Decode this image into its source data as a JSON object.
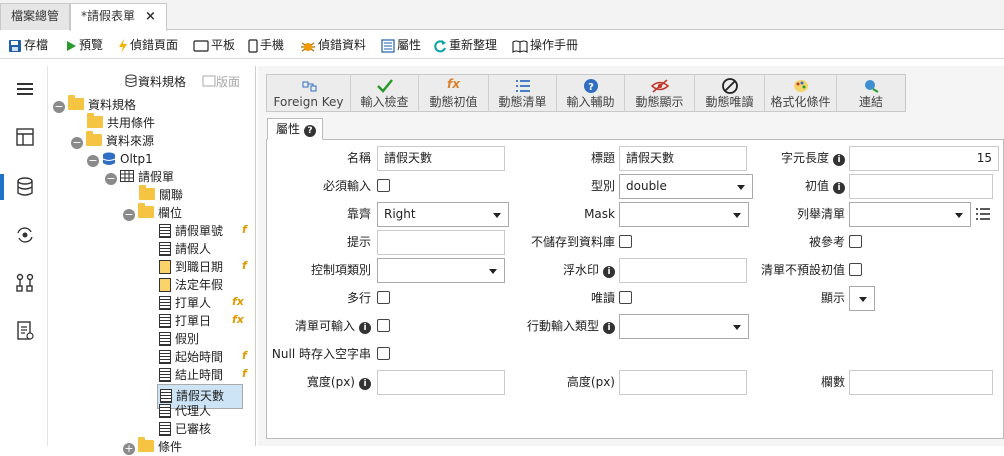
{
  "tabs": [
    {
      "label": "檔案總管"
    },
    {
      "label": "*請假表單",
      "close": "×"
    }
  ],
  "toolbar": {
    "save": "存檔",
    "preview": "預覽",
    "debug_page": "偵錯頁面",
    "tablet": "平板",
    "phone": "手機",
    "debug_data": "偵錯資料",
    "properties": "屬性",
    "reorganize": "重新整理",
    "manual": "操作手冊"
  },
  "tree_header": {
    "spec": "資料規格",
    "layout": "版面"
  },
  "tree": {
    "root": "資料規格",
    "common": "共用條件",
    "source": "資料來源",
    "db": "Oltp1",
    "table": "請假單",
    "relation": "關聯",
    "fields_group": "欄位",
    "fields": [
      "請假單號",
      "請假人",
      "到職日期",
      "法定年假",
      "打單人",
      "打單日",
      "假別",
      "起始時間",
      "結止時間",
      "請假天數",
      "代理人",
      "已審核"
    ],
    "conditions": "條件"
  },
  "ribbon": {
    "foreign_key": "Foreign Key",
    "input_check": "輸入檢查",
    "dyn_default": "動態初值",
    "dyn_list": "動態清單",
    "input_assist": "輸入輔助",
    "dyn_display": "動態顯示",
    "dyn_readonly": "動態唯讀",
    "format_cond": "格式化條件",
    "link": "連結"
  },
  "prop_tab": "屬性",
  "form": {
    "name_label": "名稱",
    "name_value": "請假天數",
    "title_label": "標題",
    "title_value": "請假天數",
    "length_label": "字元長度",
    "length_value": "15",
    "required_label": "必須輸入",
    "type_label": "型別",
    "type_value": "double",
    "initial_label": "初值",
    "align_label": "靠齊",
    "align_value": "Right",
    "mask_label": "Mask",
    "enum_label": "列舉清單",
    "hint_label": "提示",
    "nosave_label": "不儲存到資料庫",
    "referenced_label": "被參考",
    "control_label": "控制項類別",
    "watermark_label": "浮水印",
    "nodefault_label": "清單不預設初值",
    "multiline_label": "多行",
    "readonly_label": "唯讀",
    "display_label": "顯示",
    "list_input_label": "清單可輸入",
    "mobile_label": "行動輸入類型",
    "null_label": "Null 時存入空字串",
    "width_label": "寬度(px)",
    "height_label": "高度(px)",
    "columns_label": "欄數"
  }
}
